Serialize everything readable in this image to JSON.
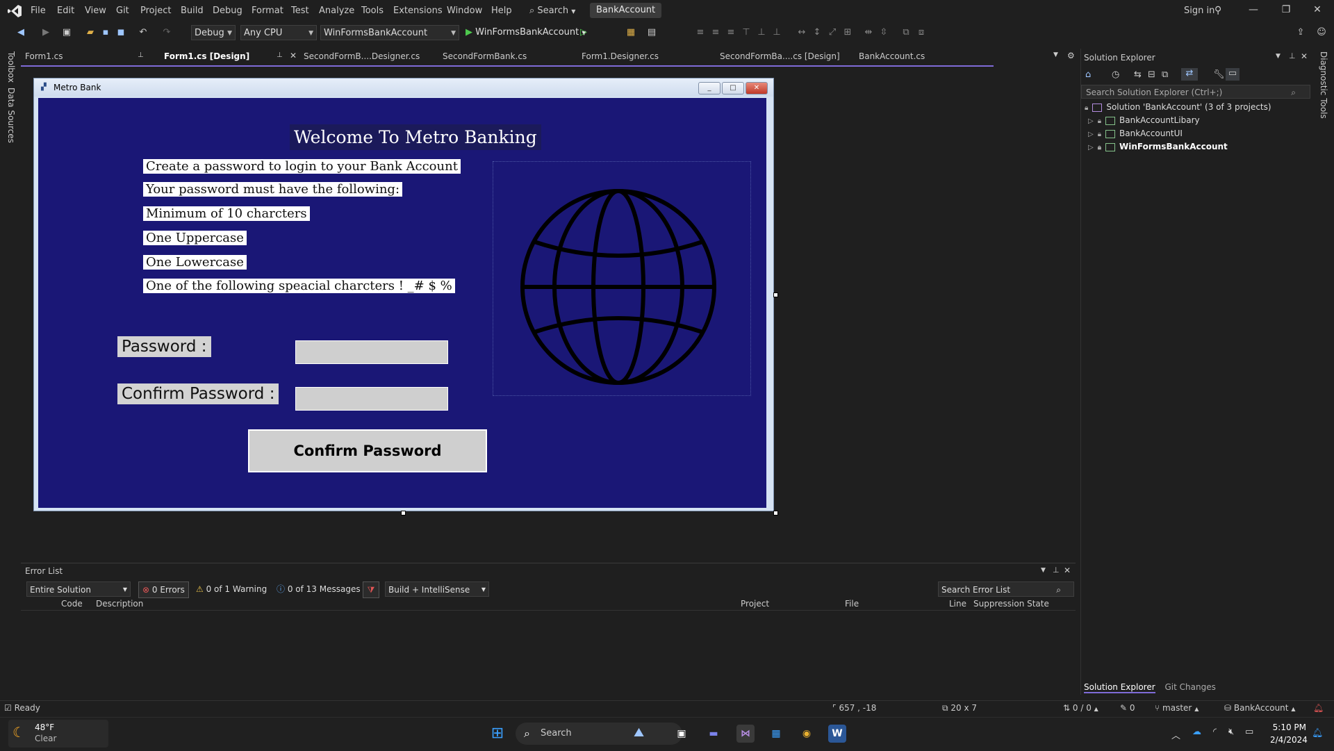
{
  "menu": {
    "items": [
      "File",
      "Edit",
      "View",
      "Git",
      "Project",
      "Build",
      "Debug",
      "Format",
      "Test",
      "Analyze",
      "Tools",
      "Extensions",
      "Window",
      "Help"
    ],
    "search_label": "Search",
    "solution_name": "BankAccount",
    "signin_label": "Sign in"
  },
  "toolbar": {
    "config": "Debug",
    "platform": "Any CPU",
    "startup_project": "WinFormsBankAccount",
    "run_label": "WinFormsBankAccount"
  },
  "side_strips": {
    "left": [
      "Toolbox",
      "Data Sources"
    ],
    "right": [
      "Diagnostic Tools"
    ]
  },
  "doc_tabs": [
    {
      "label": "Form1.cs",
      "active": false
    },
    {
      "label": "Form1.cs [Design]",
      "active": true
    },
    {
      "label": "SecondFormB....Designer.cs",
      "active": false
    },
    {
      "label": "SecondFormBank.cs",
      "active": false
    },
    {
      "label": "Form1.Designer.cs",
      "active": false
    },
    {
      "label": "SecondFormBa....cs [Design]",
      "active": false
    },
    {
      "label": "BankAccount.cs",
      "active": false
    }
  ],
  "form": {
    "title": "Metro Bank",
    "welcome": "Welcome To Metro Banking",
    "instructions": [
      "Create a password to login to your Bank Account",
      "Your password must have the following:",
      "Minimum of 10 charcters",
      "One Uppercase",
      "One Lowercase",
      "One of the following speacial charcters ! _# $ %"
    ],
    "password_label": "Password :",
    "confirm_label": "Confirm Password :",
    "password_value": "",
    "confirm_value": "",
    "confirm_button": "Confirm Password",
    "picture_icon": "globe-icon"
  },
  "solution_explorer": {
    "title": "Solution Explorer",
    "search_placeholder": "Search Solution Explorer (Ctrl+;)",
    "solution_label": "Solution 'BankAccount' (3 of 3 projects)",
    "projects": [
      "BankAccountLibary",
      "BankAccountUI",
      "WinFormsBankAccount"
    ],
    "tabs": [
      "Solution Explorer",
      "Git Changes"
    ]
  },
  "error_list": {
    "title": "Error List",
    "scope": "Entire Solution",
    "errors": "0 Errors",
    "warnings": "0 of 1 Warning",
    "messages": "0 of 13 Messages",
    "build_filter": "Build + IntelliSense",
    "search_placeholder": "Search Error List",
    "columns": [
      "Code",
      "Description",
      "Project",
      "File",
      "Line",
      "Suppression State"
    ]
  },
  "status_bar": {
    "state": "Ready",
    "position": "657 , -18",
    "size": "20 x 7",
    "line_info": "0 / 0",
    "pencil_count": "0",
    "branch": "master",
    "repo": "BankAccount"
  },
  "taskbar": {
    "weather_temp": "48°F",
    "weather_desc": "Clear",
    "search_label": "Search",
    "time": "5:10 PM",
    "date": "2/4/2024"
  },
  "colors": {
    "form_background": "#1a1776",
    "accent": "#7f6bd8"
  }
}
